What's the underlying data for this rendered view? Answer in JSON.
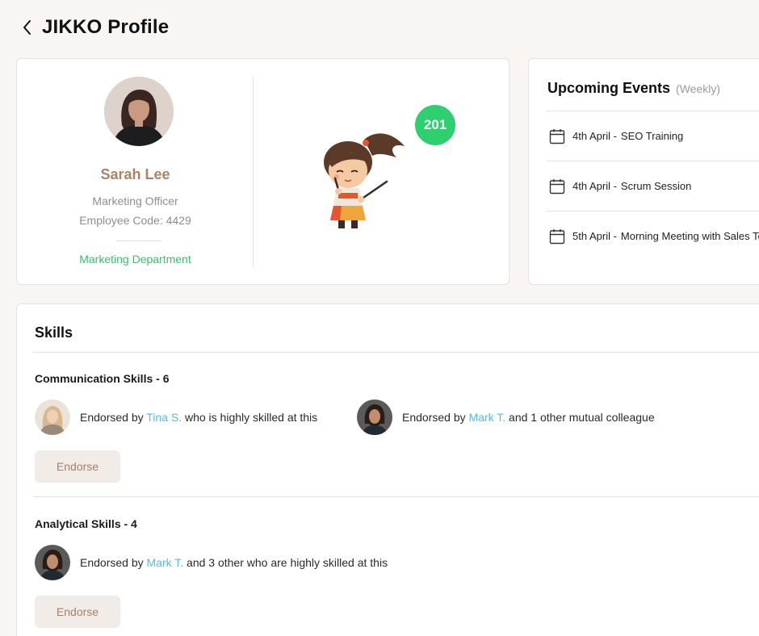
{
  "header": {
    "title": "JIKKO Profile"
  },
  "profile": {
    "name": "Sarah Lee",
    "role": "Marketing Officer",
    "employee_code": "Employee Code: 4429",
    "department": "Marketing Department",
    "points": "201"
  },
  "events": {
    "title": "Upcoming Events",
    "period": "(Weekly)",
    "items": [
      {
        "date": "4th April -",
        "name": "SEO Training"
      },
      {
        "date": "4th April -",
        "name": "Scrum Session"
      },
      {
        "date": "5th April -",
        "name": "Morning Meeting with Sales Te"
      }
    ]
  },
  "skills": {
    "title": "Skills",
    "items": [
      {
        "title": "Communication Skills - 6",
        "endorse_label": "Endorse",
        "endorsements": [
          {
            "prefix": "Endorsed by ",
            "name": "Tina S.",
            "suffix": " who is highly skilled at this"
          },
          {
            "prefix": "Endorsed by ",
            "name": "Mark T.",
            "suffix": " and 1 other mutual colleague"
          }
        ]
      },
      {
        "title": "Analytical Skills - 4",
        "endorse_label": "Endorse",
        "endorsements": [
          {
            "prefix": "Endorsed by ",
            "name": "Mark T.",
            "suffix": " and 3 other who are highly skilled at this"
          }
        ]
      }
    ]
  }
}
